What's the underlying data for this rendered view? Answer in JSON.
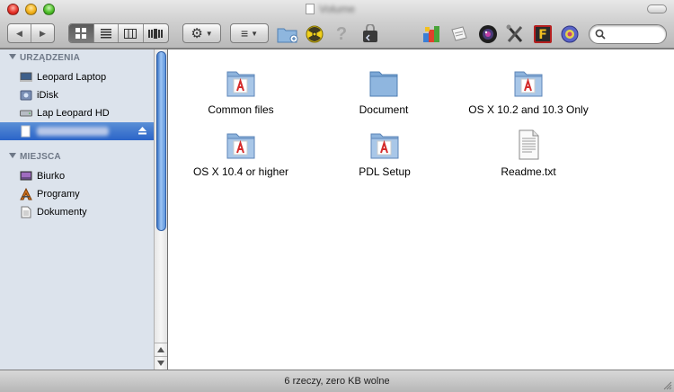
{
  "window": {
    "title": "Volume"
  },
  "toolbar": {
    "back_label": "◀",
    "forward_label": "▶",
    "views": [
      "icon-view",
      "list-view",
      "column-view",
      "coverflow-view"
    ],
    "active_view": "icon-view",
    "action_label": "⚙",
    "arrange_label": "≡",
    "help_label": "?",
    "search": {
      "value": "",
      "placeholder": ""
    }
  },
  "sidebar": {
    "devices_header": "URZĄDZENIA",
    "devices": [
      {
        "label": "Leopard Laptop",
        "icon": "computer-icon"
      },
      {
        "label": "iDisk",
        "icon": "idisk-icon"
      },
      {
        "label": "Lap Leopard HD",
        "icon": "hard-drive-icon"
      },
      {
        "label": "",
        "icon": "disk-image-icon",
        "selected": true,
        "ejectable": true
      }
    ],
    "places_header": "MIEJSCA",
    "places": [
      {
        "label": "Biurko",
        "icon": "desktop-icon"
      },
      {
        "label": "Programy",
        "icon": "applications-icon"
      },
      {
        "label": "Dokumenty",
        "icon": "documents-icon"
      }
    ]
  },
  "files": [
    {
      "name": "Common files",
      "kind": "adobe-folder"
    },
    {
      "name": "Document",
      "kind": "folder"
    },
    {
      "name": "OS X 10.2 and 10.3 Only",
      "kind": "adobe-folder"
    },
    {
      "name": "OS X 10.4 or higher",
      "kind": "adobe-folder"
    },
    {
      "name": "PDL Setup",
      "kind": "adobe-folder"
    },
    {
      "name": "Readme.txt",
      "kind": "text-file"
    }
  ],
  "status": {
    "text": "6 rzeczy, zero KB wolne"
  },
  "colors": {
    "sidebar_bg": "#dce3ec",
    "selection": "#2b64c8",
    "folder_blue": "#6f9fd0",
    "adobe_red": "#d42b2b"
  }
}
